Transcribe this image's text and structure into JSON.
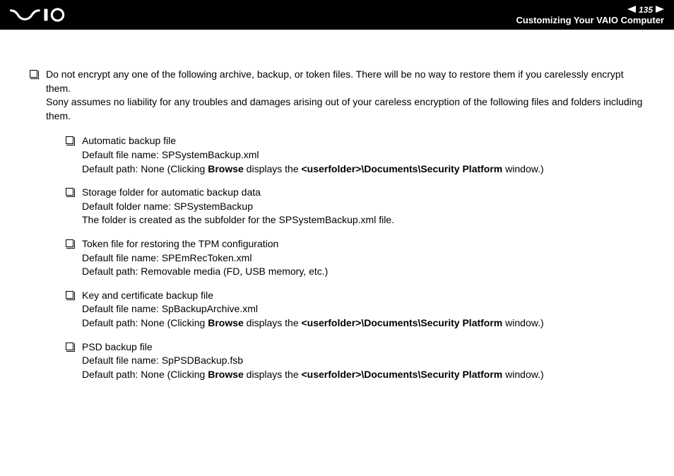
{
  "header": {
    "page_number": "135",
    "section_title": "Customizing Your VAIO Computer"
  },
  "main": {
    "intro_line1": "Do not encrypt any one of the following archive, backup, or token files. There will be no way to restore them if you carelessly encrypt them.",
    "intro_line2": "Sony assumes no liability for any troubles and damages arising out of your careless encryption of the following files and folders including them.",
    "items": [
      {
        "title": "Automatic backup file",
        "line2": "Default file name: SPSystemBackup.xml",
        "line3_prefix": "Default path: None (Clicking ",
        "line3_bold1": "Browse",
        "line3_mid": " displays the ",
        "line3_bold2": "<userfolder>\\Documents\\Security Platform",
        "line3_suffix": " window.)"
      },
      {
        "title": "Storage folder for automatic backup data",
        "line2": "Default folder name: SPSystemBackup",
        "line3_plain": "The folder is created as the subfolder for the SPSystemBackup.xml file."
      },
      {
        "title": "Token file for restoring the TPM configuration",
        "line2": "Default file name: SPEmRecToken.xml",
        "line3_plain": "Default path: Removable media (FD, USB memory, etc.)"
      },
      {
        "title": "Key and certificate backup file",
        "line2": "Default file name: SpBackupArchive.xml",
        "line3_prefix": "Default path: None (Clicking ",
        "line3_bold1": "Browse",
        "line3_mid": " displays the ",
        "line3_bold2": "<userfolder>\\Documents\\Security Platform",
        "line3_suffix": " window.)"
      },
      {
        "title": "PSD backup file",
        "line2": "Default file name: SpPSDBackup.fsb",
        "line3_prefix": "Default path: None (Clicking ",
        "line3_bold1": "Browse",
        "line3_mid": " displays the ",
        "line3_bold2": "<userfolder>\\Documents\\Security Platform",
        "line3_suffix": " window.)"
      }
    ]
  }
}
